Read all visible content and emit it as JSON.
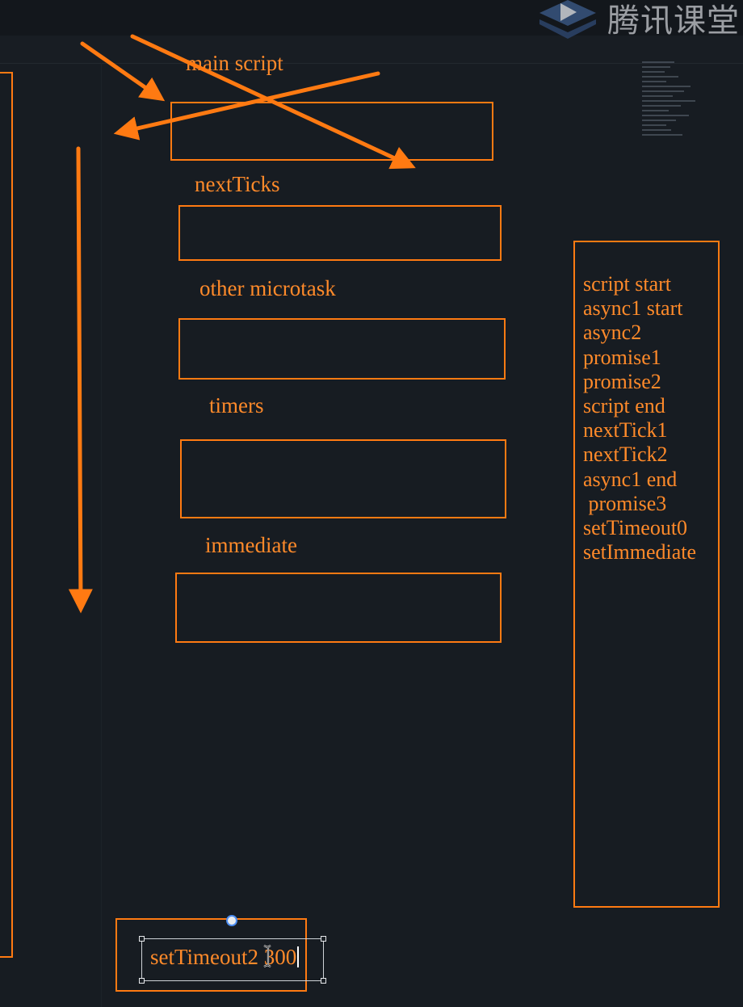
{
  "watermark": {
    "text": "腾讯课堂",
    "icon": "tencent-classroom-play-icon"
  },
  "diagram": {
    "phases": [
      {
        "label": "main script"
      },
      {
        "label": "nextTicks"
      },
      {
        "label": "other microtask"
      },
      {
        "label": "timers"
      },
      {
        "label": "immediate"
      }
    ]
  },
  "output": {
    "lines": [
      "script start",
      "async1 start",
      "async2",
      "promise1",
      "promise2",
      "script end",
      "nextTick1",
      "nextTick2",
      "async1 end",
      " promise3",
      "setTimeout0",
      "setImmediate"
    ]
  },
  "editing": {
    "text_before_cursor": "setTimeout2",
    "text_after_cursor": " 300",
    "cursor_icon": "text-i-beam-cursor-icon"
  },
  "colors": {
    "background": "#171c22",
    "accent": "#ff7a12",
    "text": "#ff8a2a"
  }
}
